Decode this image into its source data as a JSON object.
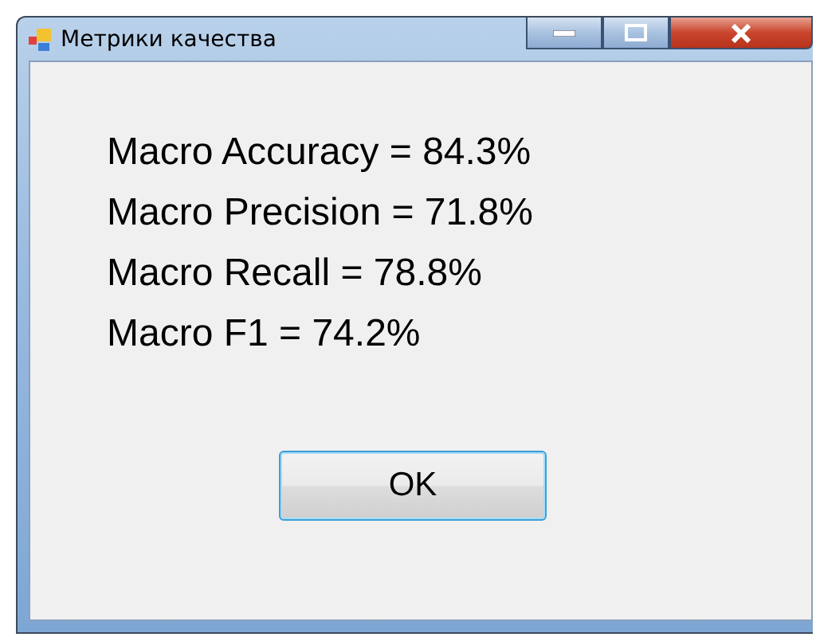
{
  "window": {
    "title": "Метрики качества"
  },
  "metrics": [
    "Macro Accuracy = 84.3%",
    "Macro Precision = 71.8%",
    "Macro Recall = 78.8%",
    "Macro F1 = 74.2%"
  ],
  "buttons": [
    {
      "label": "OK",
      "selected": true
    }
  ]
}
